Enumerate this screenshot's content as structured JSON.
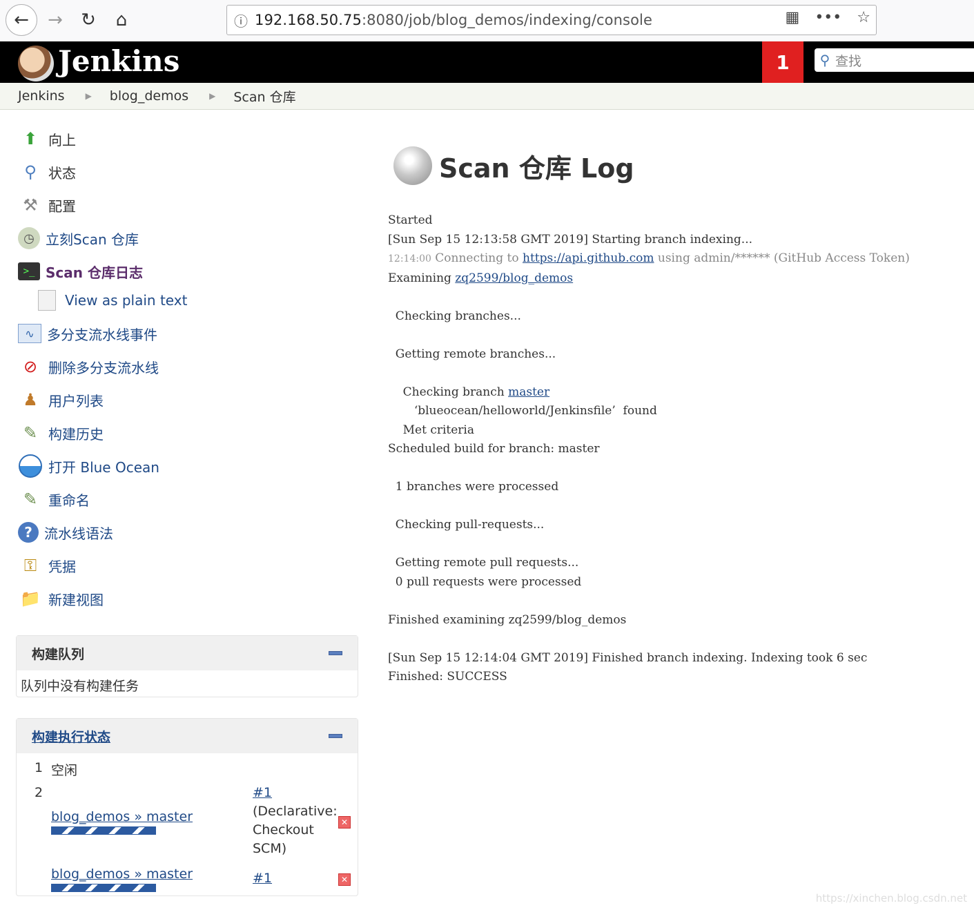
{
  "browser": {
    "url_host": "192.168.50.75",
    "url_path": ":8080/job/blog_demos/indexing/console"
  },
  "header": {
    "title": "Jenkins",
    "notification_count": "1",
    "search_placeholder": "查找"
  },
  "breadcrumb": [
    "Jenkins",
    "blog_demos",
    "Scan 仓库"
  ],
  "sidebar": {
    "items": [
      {
        "label": "向上"
      },
      {
        "label": "状态"
      },
      {
        "label": "配置"
      },
      {
        "label": "立刻Scan 仓库"
      },
      {
        "label": "Scan 仓库日志"
      },
      {
        "label": "View as plain text"
      },
      {
        "label": "多分支流水线事件"
      },
      {
        "label": "删除多分支流水线"
      },
      {
        "label": "用户列表"
      },
      {
        "label": "构建历史"
      },
      {
        "label": "打开 Blue Ocean"
      },
      {
        "label": "重命名"
      },
      {
        "label": "流水线语法"
      },
      {
        "label": "凭据"
      },
      {
        "label": "新建视图"
      }
    ]
  },
  "build_queue": {
    "title": "构建队列",
    "empty_text": "队列中没有构建任务"
  },
  "executors": {
    "title": "构建执行状态",
    "rows": [
      {
        "num": "1",
        "status": "空闲"
      },
      {
        "num": "2",
        "job": "blog_demos » master",
        "build": "#1",
        "stage_line1": "(Declarative:",
        "stage_line2": "Checkout",
        "stage_line3": "SCM)"
      },
      {
        "job": "blog_demos » master",
        "build": "#1"
      }
    ]
  },
  "main": {
    "title": "Scan 仓库 Log",
    "log": {
      "l1": "Started",
      "l2": "[Sun Sep 15 12:13:58 GMT 2019] Starting branch indexing...",
      "l3_time": "12:14:00",
      "l3_pre": " Connecting to ",
      "l3_link": "https://api.github.com",
      "l3_post": " using admin/****** (GitHub Access Token)",
      "l4_pre": "Examining ",
      "l4_link": "zq2599/blog_demos",
      "l5": "  Checking branches...",
      "l6": "  Getting remote branches...",
      "l7_pre": "    Checking branch ",
      "l7_link": "master",
      "l8": "       ‘blueocean/helloworld/Jenkinsfile’  found",
      "l9": "    Met criteria",
      "l10": "Scheduled build for branch: master",
      "l11": "  1 branches were processed",
      "l12": "  Checking pull-requests...",
      "l13": "  Getting remote pull requests...",
      "l14": "  0 pull requests were processed",
      "l15": "Finished examining zq2599/blog_demos",
      "l16": "[Sun Sep 15 12:14:04 GMT 2019] Finished branch indexing. Indexing took 6 sec",
      "l17": "Finished: SUCCESS"
    }
  },
  "watermark": "https://xinchen.blog.csdn.net"
}
